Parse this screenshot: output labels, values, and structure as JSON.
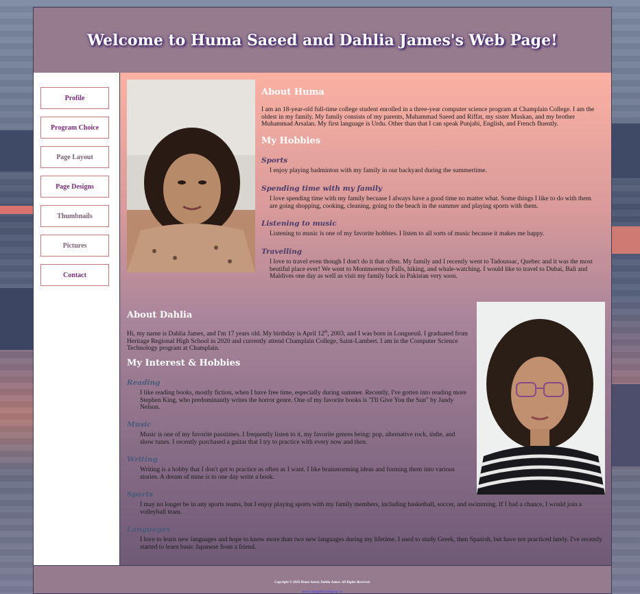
{
  "header": {
    "title": "Welcome to Huma Saeed and Dahlia James's Web Page!"
  },
  "nav": [
    {
      "label": "Profile"
    },
    {
      "label": "Program Choice"
    },
    {
      "label": "Page Layout"
    },
    {
      "label": "Page Designs"
    },
    {
      "label": "Thumbnails"
    },
    {
      "label": "Pictures"
    },
    {
      "label": "Contact"
    }
  ],
  "huma": {
    "about_title": "About Huma",
    "about_text": "I am an 18-year-old full-time college student enrolled in a three-year computer science program at Champlain College. I am the oldest in my family. My family consists of my parents, Muhammad Saeed and Riffat, my sister Muskan, and my brother Muhammad Arsalan. My first language is Urdu. Other than that I can speak Punjabi, English, and French fluently.",
    "hobbies_title": "My Hobbies",
    "hobbies": [
      {
        "title": "Sports",
        "text": "I enjoy playing badminton with my family in our backyard during the summertime."
      },
      {
        "title": "Spending time with my family",
        "text": "I love spending time with my family becuase I always have a good time no matter what. Some things I like to do with them are going shopping, cooking, cleaning, going to the beach in the summer and playing sports with them."
      },
      {
        "title": "Listening to music",
        "text": "Listening to music is one of my favorite hobbies. I listen to all sorts of music because it makes me happy."
      },
      {
        "title": "Travelling",
        "text": "I love to travel even though I don't do it that often. My family and I recently went to Tadoussac, Quebec and it was the most beutiful place ever! We went to Montmorency Falls, hiking, and whale-watching. I would like to travel to Dubai, Bali and Maldives one day as well as visit my family back in Pakistan very soon."
      }
    ]
  },
  "dahlia": {
    "about_title": "About Dahlia",
    "about_text_1": "Hi, my name is Dahlia James, and I'm 17 years old. My birthday is April 12",
    "about_text_sup": "th",
    "about_text_2": ", 2003, and I was born in Longueuil. I graduated from Heritage Regional High School in 2020 and currently attend Champlain College, Saint-Lambert. I am in the Computer Science Technology program at Champlain.",
    "hobbies_title": "My Interest & Hobbies",
    "hobbies": [
      {
        "title": "Reading",
        "text": "I like reading books, mostly fiction, when I have free time, especially during summer. Recently, I've gotten into reading more Stephen King, who predominantly writes the horror genre. One of my favorite books is \"I'll Give You the Sun\" by Jandy Nelson."
      },
      {
        "title": "Music",
        "text": "Music is one of my favorite passtimes. I frequently listen to it, my favorite genres being: pop, alternative rock, indie, and show tunes. I recently purchased a guitar that I try to practice with every now and then."
      },
      {
        "title": "Writing",
        "text": "Writing is a hobby that I don't get to practice as often as I want. I like brainstorming ideas and forming them into various stories. A dream of mine is to one day write a book."
      },
      {
        "title": "Sports",
        "text": "I may no longer be in any sports teams, but I enjoy playing sports with my family members, including basketball, soccer, and swimming. If I had a chance, I would join a volleyball team."
      },
      {
        "title": "Languages",
        "text": "I love to learn new languages and hope to know more than two new languages during my lifetime. I used to study Greek, then Spanish, but have not practiced lately. I've recently started to learn basic Japanese from a friend."
      }
    ]
  },
  "footer": {
    "copyright": "Copyright © 2020 Huma Saeed, Dahlia James. All Rights Reserved.",
    "link": "www.champlaincollege.qc.ca"
  },
  "colors": {
    "header_bg": "#967b8f",
    "nav_text_active": "#7a2a7a",
    "nav_text_muted": "#7a5f75",
    "huma_sub": "#4a3a6a",
    "dahlia_sub": "#4a5a7a"
  }
}
